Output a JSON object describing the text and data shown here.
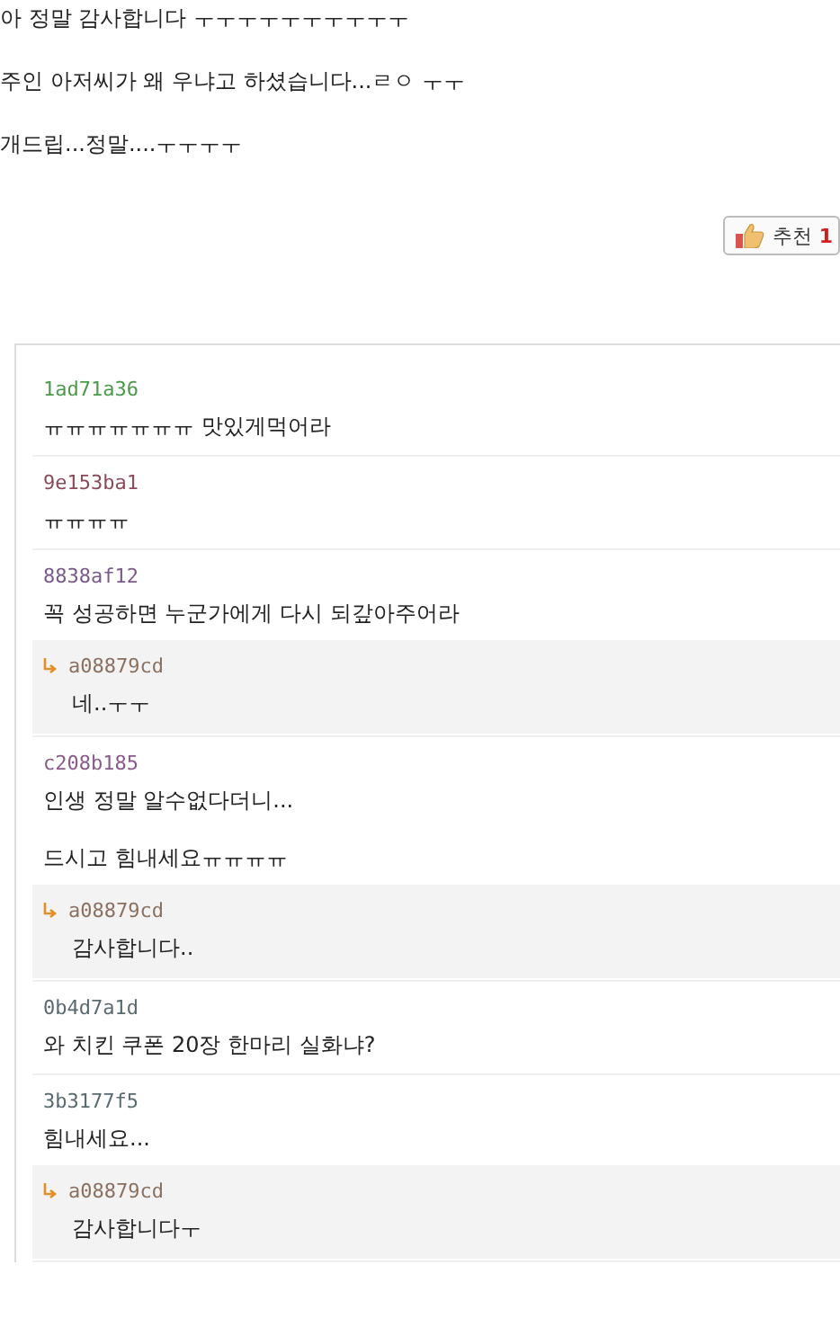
{
  "post": {
    "paragraphs": [
      "아 정말 감사합니다 ㅜㅜㅜㅜㅜㅜㅜㅜㅜㅜ",
      "주인 아저씨가 왜 우냐고 하셨습니다...ㄹㅇ ㅜㅜ",
      "개드립...정말....ㅜㅜㅜㅜ"
    ]
  },
  "recommend": {
    "label": "추천",
    "count": "1"
  },
  "comments": [
    {
      "author": "1ad71a36",
      "color": "#4a9a4a",
      "lines": [
        "ㅠㅠㅠㅠㅠㅠㅠ 맛있게먹어라"
      ]
    },
    {
      "author": "9e153ba1",
      "color": "#8a4a5a",
      "lines": [
        "ㅠㅠㅠㅠ"
      ]
    },
    {
      "author": "8838af12",
      "color": "#7a5a8a",
      "lines": [
        "꼭 성공하면 누군가에게 다시 되갚아주어라"
      ],
      "replies": [
        {
          "author": "a08879cd",
          "color": "#8a7060",
          "lines": [
            "네..ㅜㅜ"
          ]
        }
      ]
    },
    {
      "author": "c208b185",
      "color": "#8a5a8a",
      "lines": [
        "인생 정말 알수없다더니...",
        "드시고 힘내세요ㅠㅠㅠㅠ"
      ],
      "replies": [
        {
          "author": "a08879cd",
          "color": "#8a7060",
          "lines": [
            "감사합니다.."
          ]
        }
      ]
    },
    {
      "author": "0b4d7a1d",
      "color": "#5a6a70",
      "lines": [
        "와 치킨 쿠폰 20장 한마리 실화냐?"
      ]
    },
    {
      "author": "3b3177f5",
      "color": "#5a6a70",
      "lines": [
        "힘내세요..."
      ],
      "replies": [
        {
          "author": "a08879cd",
          "color": "#8a7060",
          "lines": [
            "감사합니다ㅜ"
          ]
        }
      ]
    }
  ]
}
